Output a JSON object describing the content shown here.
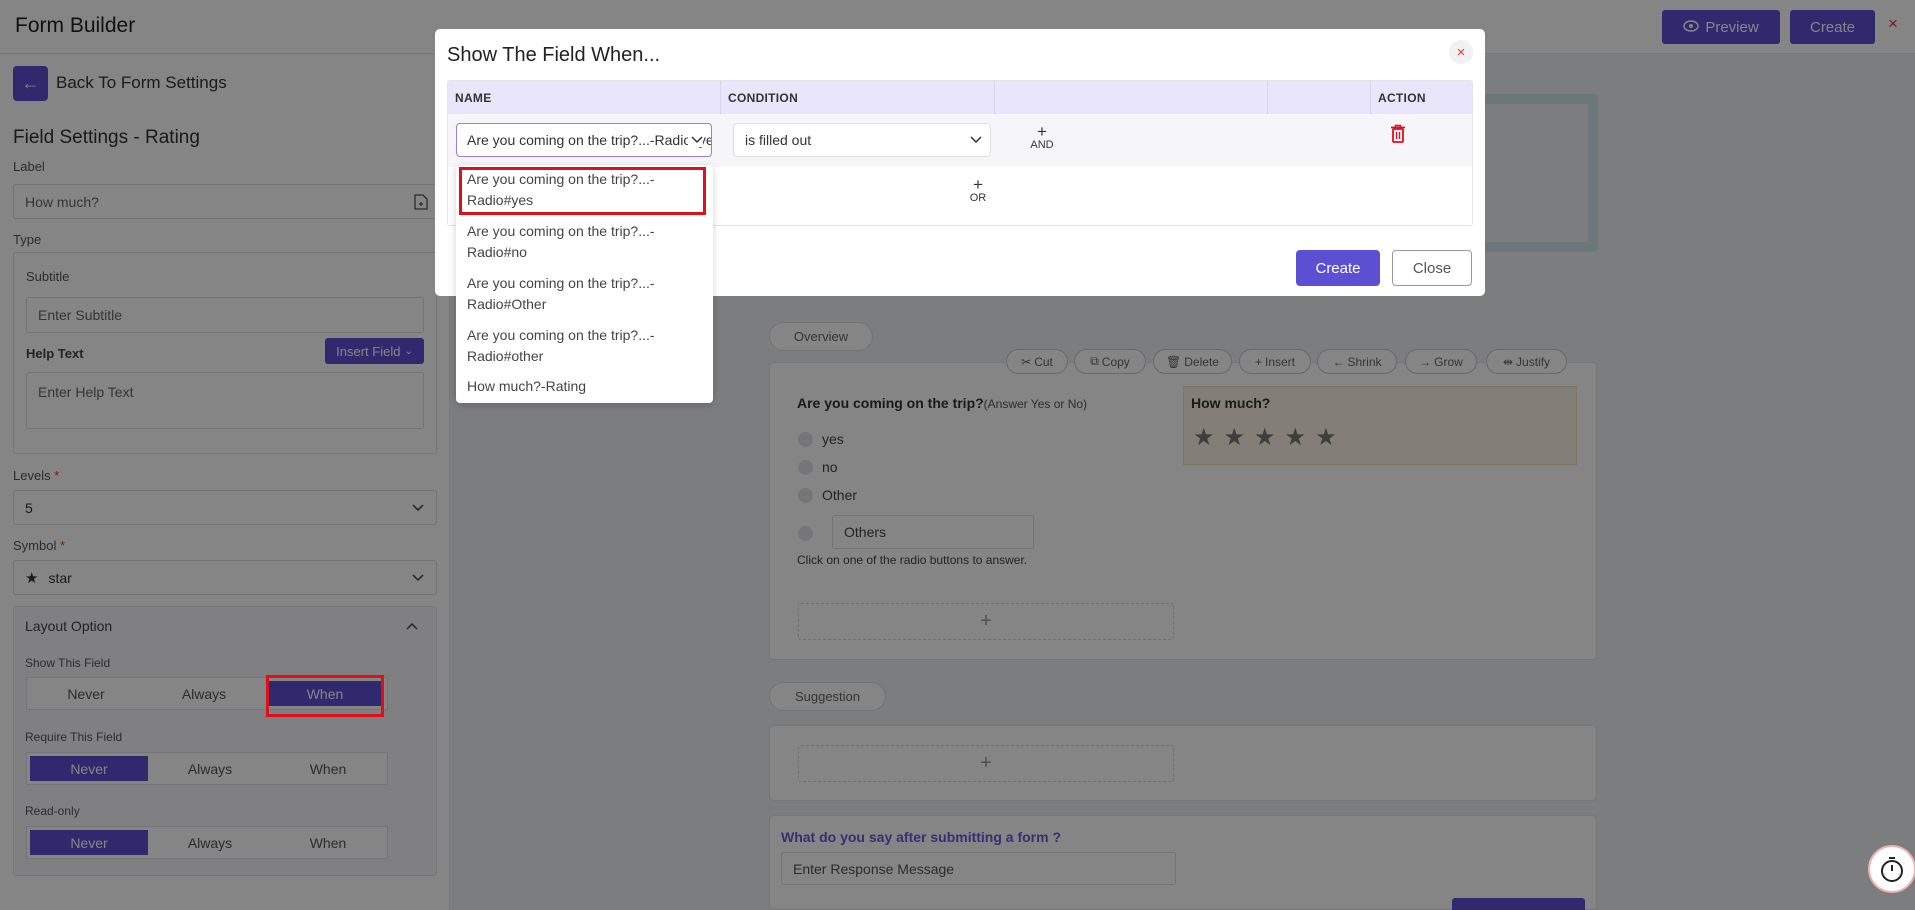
{
  "header": {
    "app_title": "Form Builder",
    "preview_label": "Preview",
    "create_label": "Create",
    "close_symbol": "×"
  },
  "sidebar": {
    "back_label": "Back To Form Settings",
    "section_title": "Field Settings - Rating",
    "label_caption": "Label",
    "label_value": "How much?",
    "type_caption": "Type",
    "subtitle_caption": "Subtitle",
    "subtitle_placeholder": "Enter Subtitle",
    "help_caption": "Help Text",
    "help_placeholder": "Enter Help Text",
    "insert_field_label": "Insert Field",
    "levels_caption": "Levels",
    "levels_value": "5",
    "symbol_caption": "Symbol",
    "symbol_value": "star",
    "layout_option": "Layout Option",
    "show_field": {
      "caption": "Show This Field",
      "options": [
        "Never",
        "Always",
        "When"
      ],
      "selected": "When"
    },
    "require_field": {
      "caption": "Require This Field",
      "options": [
        "Never",
        "Always",
        "When"
      ],
      "selected": "Never"
    },
    "read_only": {
      "caption": "Read-only",
      "options": [
        "Never",
        "Always",
        "When"
      ],
      "selected": "Never"
    },
    "required_mark": "*"
  },
  "canvas": {
    "overview_tab": "Overview",
    "suggestion_tab": "Suggestion",
    "toolbar": [
      "Cut",
      "Copy",
      "Delete",
      "Insert",
      "Shrink",
      "Grow",
      "Justify"
    ],
    "question": "Are you coming on the trip?",
    "question_hint": "(Answer Yes or No)",
    "radio_options": [
      "yes",
      "no",
      "Other"
    ],
    "others_value": "Others",
    "radio_help": "Click on one of the radio buttons to answer.",
    "rating_title": "How much?",
    "rating_levels": 5,
    "response_question": "What do you say after submitting a form ?",
    "response_placeholder": "Enter Response Message",
    "add_symbol": "+"
  },
  "modal": {
    "title": "Show The Field When...",
    "close_symbol": "×",
    "columns": [
      "NAME",
      "CONDITION",
      "",
      "",
      "ACTION"
    ],
    "name_selected": "Are you coming on the trip?...-Radio#yes",
    "condition_selected": "is filled out",
    "and_label": "AND",
    "or_label": "OR",
    "plus_symbol": "+",
    "create_label": "Create",
    "close_label": "Close"
  },
  "dropdown": {
    "options": [
      {
        "line1": "Are you coming on the trip?...-",
        "line2": "Radio#yes"
      },
      {
        "line1": "Are you coming on the trip?...-",
        "line2": "Radio#no"
      },
      {
        "line1": "Are you coming on the trip?...-",
        "line2": "Radio#Other"
      },
      {
        "line1": "Are you coming on the trip?...-",
        "line2": "Radio#other"
      },
      {
        "line1": "How much?-Rating",
        "line2": ""
      }
    ],
    "highlighted_index": 0
  },
  "colors": {
    "accent": "#5d4fd3",
    "danger": "#e0101a",
    "header_row": "#e9e6fb"
  }
}
